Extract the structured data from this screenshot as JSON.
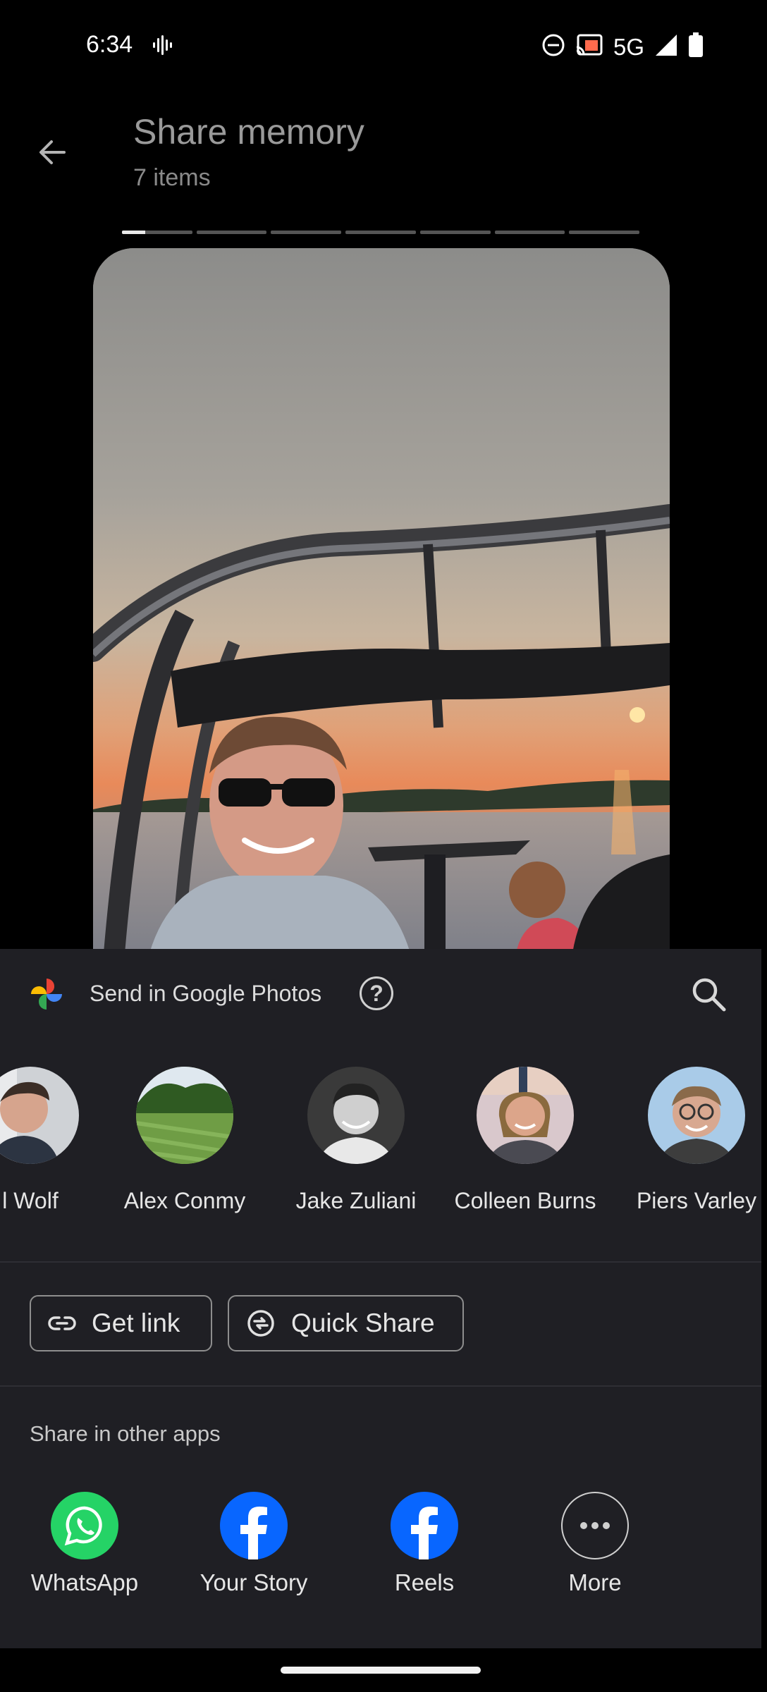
{
  "status_bar": {
    "time": "6:34",
    "network": "5G",
    "icons": [
      "voice-waveform-icon",
      "do-not-disturb-icon",
      "cast-icon",
      "signal-icon",
      "battery-icon"
    ]
  },
  "header": {
    "title": "Share memory",
    "subtitle": "7 items",
    "back_icon": "arrow-back-icon"
  },
  "progress": {
    "segments": 7,
    "current_segment": 1,
    "current_fill": 0.33
  },
  "photo": {
    "description_icon": "memory-photo"
  },
  "sheet": {
    "send_label": "Send in Google Photos",
    "help_icon": "help-icon",
    "help_glyph": "?",
    "search_icon": "search-icon",
    "contacts": [
      {
        "name": "l Wolf"
      },
      {
        "name": "Alex Conmy"
      },
      {
        "name": "Jake Zuliani"
      },
      {
        "name": "Colleen Burns"
      },
      {
        "name": "Piers Varley"
      }
    ],
    "get_link_label": "Get link",
    "quick_share_label": "Quick Share",
    "other_apps_label": "Share in other apps",
    "apps": [
      {
        "label": "WhatsApp",
        "color": "#25d366"
      },
      {
        "label": "Your Story",
        "color": "#0866ff"
      },
      {
        "label": "Reels",
        "color": "#0866ff"
      },
      {
        "label": "More",
        "color": "#1f1f24"
      }
    ]
  },
  "colors": {
    "background": "#000000",
    "sheet": "#1f1f24",
    "facebook_blue": "#0866ff",
    "whatsapp_green": "#25d366"
  }
}
